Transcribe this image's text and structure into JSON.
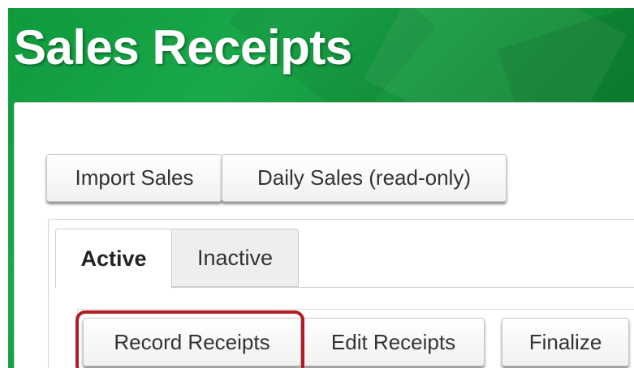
{
  "header": {
    "title": "Sales Receipts"
  },
  "toolbar_top": {
    "import_label": "Import Sales",
    "daily_label": "Daily Sales (read-only)"
  },
  "tabs": [
    {
      "label": "Active",
      "selected": true
    },
    {
      "label": "Inactive",
      "selected": false
    }
  ],
  "actions": {
    "record_label": "Record Receipts",
    "edit_label": "Edit Receipts",
    "finalize_label": "Finalize"
  },
  "colors": {
    "header_green": "#128f38",
    "highlight_red": "#b01c22"
  }
}
